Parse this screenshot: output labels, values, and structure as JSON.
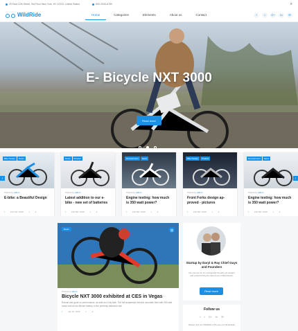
{
  "topbar": {
    "address": "25 East 12th Street, 3rd Floor New York, NY 12222, United States",
    "phone": "800-2345-6789",
    "search_icon": "search-icon"
  },
  "brand": {
    "name": "WildRide",
    "color": "#1a8fe3"
  },
  "nav": {
    "items": [
      "Home",
      "Categories",
      "Elements",
      "About us",
      "Contact"
    ],
    "active": "Home"
  },
  "socials": [
    "f",
    "t",
    "G+",
    "in",
    "✉"
  ],
  "hero": {
    "title": "E- Bicycle NXT 3000",
    "button": "Read more",
    "slides": 3,
    "active_slide": 1
  },
  "cards": [
    {
      "tags": [
        "Bike Design",
        "News"
      ],
      "meta_prefix": "Posted by",
      "author": "admin",
      "title": "E-bike: a Beautiful Design",
      "date": "Feb 5th, 2016",
      "comments": "4"
    },
    {
      "tags": [
        "News",
        "Product"
      ],
      "meta_prefix": "Posted by",
      "author": "admin",
      "title": "Latest addition to our e-bike - new set of batteries",
      "date": "Feb 8th, 2016",
      "comments": "4"
    },
    {
      "tags": [
        "Development",
        "News"
      ],
      "meta_prefix": "Posted by",
      "author": "admin",
      "title": "Engine testing: how much is 350 watt power?",
      "date": "Feb 8th, 2016",
      "comments": "2"
    },
    {
      "tags": [
        "Bike Design",
        "Product"
      ],
      "meta_prefix": "Posted by",
      "author": "admin",
      "title": "Front Forks design ap-proved - pictures",
      "date": "Feb 8th, 2016",
      "comments": "4"
    },
    {
      "tags": [
        "Development",
        "News"
      ],
      "meta_prefix": "Posted by",
      "author": "admin",
      "title": "Engine testing: how much is 350 watt power?",
      "date": "Feb 8th, 2016",
      "comments": "2"
    }
  ],
  "feature": {
    "tag": "News",
    "meta_prefix": "Posted by",
    "author": "admin",
    "title": "Bicycle NXT 3000 exhibited at CES in Vegas",
    "text": "Robust and good on performance, as safe as a city bike. The full suspension electric mountain bike with 350 watt motor and an ion-lithium battery, is the perfectly balanced ride.",
    "date": "Jan 20, 2016",
    "comments": "4"
  },
  "side": {
    "title": "Startup by Daryl & Ray Chief Guys and Founders",
    "text": "Our journey for an ecologically friendly yet elegant and powerful bicycle started out in Manchester.",
    "button": "Read more"
  },
  "follow": {
    "title": "Follow us",
    "icons": [
      "f",
      "t",
      "G+",
      "in",
      "✉"
    ],
    "text": "Please visit our WildRide's Wh see our full website"
  }
}
